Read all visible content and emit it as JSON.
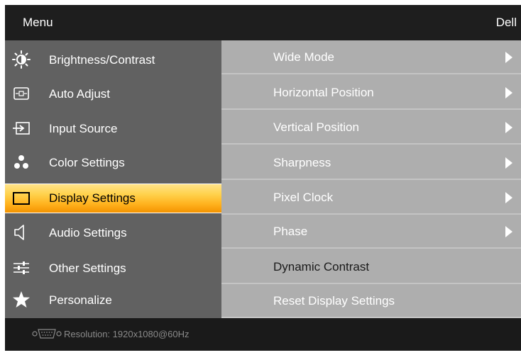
{
  "header": {
    "title": "Menu",
    "brand": "Dell"
  },
  "colors": {
    "active_highlight": "#ffb21e",
    "left_panel": "#616161",
    "right_panel": "#aeaeae",
    "bar": "#1a1a1a"
  },
  "menu": [
    {
      "label": "Brightness/Contrast",
      "icon": "brightness-icon",
      "active": false
    },
    {
      "label": "Auto Adjust",
      "icon": "auto-adjust-icon",
      "active": false
    },
    {
      "label": "Input Source",
      "icon": "input-source-icon",
      "active": false
    },
    {
      "label": "Color Settings",
      "icon": "color-settings-icon",
      "active": false
    },
    {
      "label": "Display Settings",
      "icon": "display-icon",
      "active": true
    },
    {
      "label": "Audio Settings",
      "icon": "speaker-icon",
      "active": false
    },
    {
      "label": "Other Settings",
      "icon": "other-settings-icon",
      "active": false
    },
    {
      "label": "Personalize",
      "icon": "star-icon",
      "active": false
    }
  ],
  "submenu": [
    {
      "label": "Wide Mode",
      "has_arrow": true
    },
    {
      "label": "Horizontal Position",
      "has_arrow": true
    },
    {
      "label": "Vertical Position",
      "has_arrow": true
    },
    {
      "label": "Sharpness",
      "has_arrow": true
    },
    {
      "label": "Pixel Clock",
      "has_arrow": true
    },
    {
      "label": "Phase",
      "has_arrow": true
    },
    {
      "label": "Dynamic Contrast",
      "has_arrow": false
    },
    {
      "label": "Reset Display Settings",
      "has_arrow": false
    }
  ],
  "status": {
    "resolution": "Resolution:  1920x1080@60Hz",
    "icon": "vga-connector-icon"
  }
}
